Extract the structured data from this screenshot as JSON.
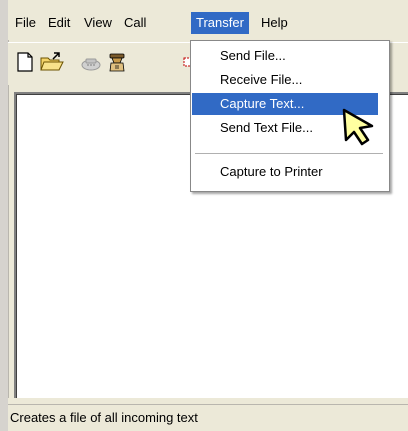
{
  "menubar": {
    "items": [
      "File",
      "Edit",
      "View",
      "Call",
      "Transfer",
      "Help"
    ]
  },
  "toolbar": {
    "icons": [
      "new-document-icon",
      "open-folder-icon",
      "disconnected-phone-icon",
      "call-icon",
      "properties-icon"
    ]
  },
  "transfer_menu": {
    "items": [
      "Send File...",
      "Receive File...",
      "Capture Text...",
      "Send Text File...",
      "Capture to Printer"
    ],
    "highlighted": "Capture Text..."
  },
  "statusbar": {
    "text": "Creates a file of all incoming text"
  },
  "colors": {
    "chrome": "#ece9d8",
    "highlight": "#316ac5",
    "cursor": "#ffffa0"
  }
}
